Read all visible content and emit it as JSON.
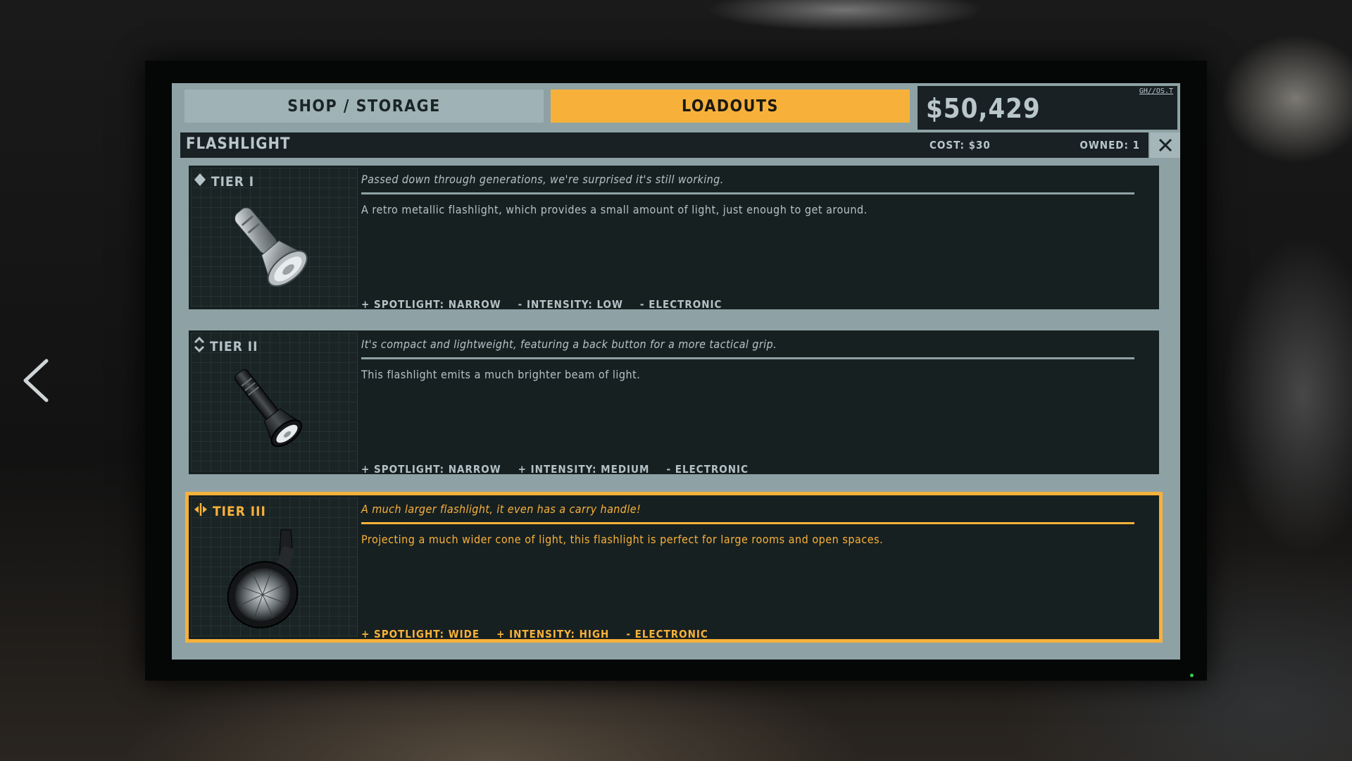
{
  "tabs": {
    "shop_storage": "SHOP / STORAGE",
    "loadouts": "LOADOUTS",
    "active": "loadouts"
  },
  "wallet": {
    "money": "$50,429",
    "os_tag": "GH//OS.T"
  },
  "item": {
    "name": "FLASHLIGHT",
    "cost": "COST: $30",
    "owned": "OWNED: 1"
  },
  "tiers": [
    {
      "label": "TIER I",
      "icon": "diamond-icon",
      "flavor": "Passed down through generations, we're surprised it's still working.",
      "description": "A retro metallic flashlight, which provides a small amount of light, just enough to get around.",
      "stats": [
        "+ SPOTLIGHT: NARROW",
        "- INTENSITY: LOW",
        "- ELECTRONIC"
      ],
      "selected": false
    },
    {
      "label": "TIER II",
      "icon": "double-chevron-icon",
      "flavor": "It's compact and lightweight, featuring a back button for a more tactical grip.",
      "description": "This flashlight emits a much brighter beam of light.",
      "stats": [
        "+ SPOTLIGHT: NARROW",
        "+ INTENSITY: MEDIUM",
        "- ELECTRONIC"
      ],
      "selected": false
    },
    {
      "label": "TIER III",
      "icon": "split-arrows-icon",
      "flavor": "A much larger flashlight, it even has a carry handle!",
      "description": "Projecting a much wider cone of light, this flashlight is perfect for large rooms and open spaces.",
      "stats": [
        "+ SPOTLIGHT: WIDE",
        "+ INTENSITY: HIGH",
        "- ELECTRONIC"
      ],
      "selected": true
    }
  ],
  "colors": {
    "accent": "#f7b13a",
    "frame": "#8ea2a5",
    "panel": "#172021",
    "text": "#b4c2c6"
  }
}
